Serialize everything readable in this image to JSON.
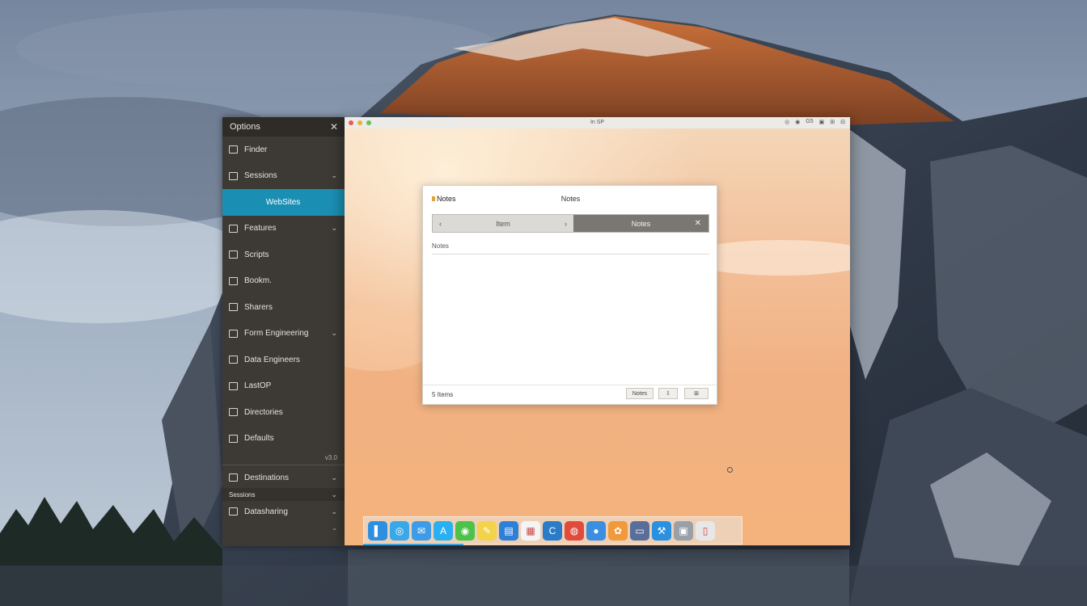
{
  "sidebar": {
    "title": "Options",
    "close_glyph": "✕",
    "items": [
      {
        "label": "Finder",
        "icon": "panel-icon",
        "chevron": ""
      },
      {
        "label": "Sessions",
        "icon": "sessions-icon",
        "chevron": "⌄"
      },
      {
        "label": "WebSites",
        "icon": "",
        "chevron": "",
        "active": true
      },
      {
        "label": "Features",
        "icon": "features-icon",
        "chevron": "⌄"
      },
      {
        "label": "Scripts",
        "icon": "scripts-icon",
        "chevron": ""
      },
      {
        "label": "Bookm.",
        "icon": "bookmarks-icon",
        "chevron": ""
      },
      {
        "label": "Sharers",
        "icon": "share-icon",
        "chevron": ""
      },
      {
        "label": "Form Engineering",
        "icon": "form-icon",
        "chevron": "⌄"
      },
      {
        "label": "Data Engineers",
        "icon": "data-icon",
        "chevron": ""
      },
      {
        "label": "LastOP",
        "icon": "last-icon",
        "chevron": ""
      },
      {
        "label": "Directories",
        "icon": "directory-icon",
        "chevron": ""
      },
      {
        "label": "Defaults",
        "icon": "defaults-icon",
        "chevron": ""
      }
    ],
    "small_label": "v3.0",
    "extra_items": [
      {
        "label": "Destinations",
        "chevron": "⌄"
      },
      {
        "label": "Sessions",
        "chevron": "⌄"
      },
      {
        "label": "Datasharing",
        "chevron": "⌄"
      }
    ],
    "footer_chevron": "⌄"
  },
  "window": {
    "title": "In SP",
    "traffic_lights": [
      "#e95c4c",
      "#e9b23a",
      "#5fc455"
    ],
    "right_icons": [
      "◎",
      "◉",
      "G5",
      "▣",
      "⊞",
      "⊟"
    ]
  },
  "dialog": {
    "app_name": "Notes",
    "title": "Notes",
    "tab_left_icon": "‹",
    "tab_left_label": "Item",
    "tab_left_arrow": "›",
    "tab_right_label": "Notes",
    "tab_right_close": "✕",
    "section_label": "Notes",
    "status": "5 Items",
    "buttons": [
      "Notes",
      "⇩",
      "⊞"
    ]
  },
  "dock": {
    "icons": [
      {
        "name": "finder-icon",
        "color": "#2d8fe0",
        "glyph": "▌"
      },
      {
        "name": "safari-icon",
        "color": "#3aa8e8",
        "glyph": "◎"
      },
      {
        "name": "mail-icon",
        "color": "#3c9ce8",
        "glyph": "✉"
      },
      {
        "name": "appstore-icon",
        "color": "#2ab0f0",
        "glyph": "A"
      },
      {
        "name": "messages-icon",
        "color": "#4cc24a",
        "glyph": "◉"
      },
      {
        "name": "notes-icon",
        "color": "#f2d34a",
        "glyph": "✎"
      },
      {
        "name": "preview-icon",
        "color": "#2e7fd8",
        "glyph": "▤"
      },
      {
        "name": "calendar-icon",
        "color": "#f4f4f4",
        "glyph": "▦"
      },
      {
        "name": "ccleaner-icon",
        "color": "#2b7cc8",
        "glyph": "C"
      },
      {
        "name": "chrome-icon",
        "color": "#e14b3b",
        "glyph": "◍"
      },
      {
        "name": "facetime-icon",
        "color": "#3b8ee0",
        "glyph": "●"
      },
      {
        "name": "photos-icon",
        "color": "#f09a3a",
        "glyph": "✿"
      },
      {
        "name": "monitor-icon",
        "color": "#5a6e9a",
        "glyph": "▭"
      },
      {
        "name": "xcode-icon",
        "color": "#2a90e0",
        "glyph": "⚒"
      },
      {
        "name": "screenshot-icon",
        "color": "#9aa0a8",
        "glyph": "▣"
      },
      {
        "name": "trash-icon",
        "color": "#e7e7e7",
        "glyph": "▯"
      }
    ]
  }
}
